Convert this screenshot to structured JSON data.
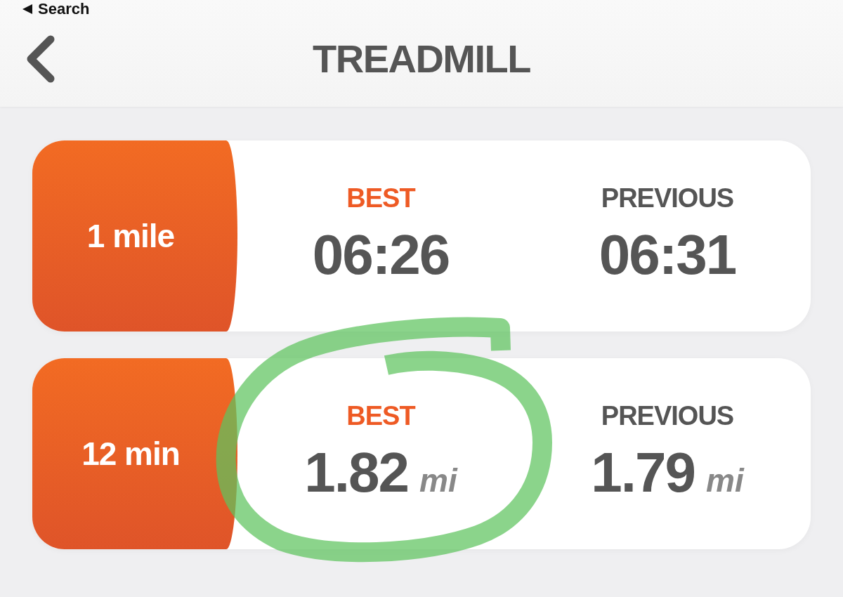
{
  "status_bar": {
    "back_label": "Search"
  },
  "header": {
    "title": "TREADMILL"
  },
  "cards": [
    {
      "label": "1 mile",
      "stats": [
        {
          "kind": "best",
          "label": "BEST",
          "value": "06:26",
          "circled": false
        },
        {
          "kind": "previous",
          "label": "PREVIOUS",
          "value": "06:31",
          "circled": false
        }
      ]
    },
    {
      "label": "12 min",
      "stats": [
        {
          "kind": "best",
          "label": "BEST",
          "value": "1.82",
          "unit": "mi",
          "circled": true
        },
        {
          "kind": "previous",
          "label": "PREVIOUS",
          "value": "1.79",
          "unit": "mi",
          "circled": false
        }
      ]
    }
  ]
}
